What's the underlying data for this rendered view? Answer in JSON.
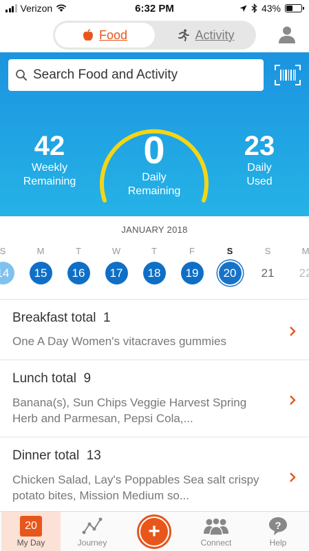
{
  "status_bar": {
    "carrier": "Verizon",
    "time": "6:32 PM",
    "battery": "43%",
    "battery_level": 0.43
  },
  "header": {
    "tabs": [
      {
        "label": "Food",
        "icon": "apple-icon",
        "active": true
      },
      {
        "label": "Activity",
        "icon": "runner-icon",
        "active": false
      }
    ],
    "profile_icon": "person-icon"
  },
  "search": {
    "placeholder": "Search Food and Activity",
    "barcode_icon": "barcode-scanner-icon"
  },
  "summary": {
    "weekly": {
      "value": "42",
      "label_line1": "Weekly",
      "label_line2": "Remaining"
    },
    "daily": {
      "value": "0",
      "label_line1": "Daily",
      "label_line2": "Remaining"
    },
    "used": {
      "value": "23",
      "label_line1": "Daily",
      "label_line2": "Used"
    },
    "gauge_color": "#f4d616",
    "hero_color": "#1c93e0"
  },
  "calendar": {
    "month": "JANUARY 2018",
    "weekdays": [
      "S",
      "M",
      "T",
      "W",
      "T",
      "F",
      "S",
      "S",
      "M"
    ],
    "selected_weekday_index": 6,
    "dates": [
      "14",
      "15",
      "16",
      "17",
      "18",
      "19",
      "20",
      "21",
      "22"
    ],
    "selected_date": "20"
  },
  "meals": [
    {
      "name": "Breakfast total",
      "total": "1",
      "items": "One A Day Women's vitacraves gummies"
    },
    {
      "name": "Lunch total",
      "total": "9",
      "items": "Banana(s), Sun Chips Veggie Harvest Spring Herb and Parmesan, Pepsi Cola,..."
    },
    {
      "name": "Dinner total",
      "total": "13",
      "items": "Chicken Salad, Lay's Poppables Sea salt crispy potato bites, Mission Medium so..."
    }
  ],
  "tabbar": {
    "items": [
      {
        "label": "My Day",
        "icon": "calendar-icon",
        "badge": "20",
        "active": true
      },
      {
        "label": "Journey",
        "icon": "journey-graph-icon"
      },
      {
        "label": "",
        "icon": "add-icon"
      },
      {
        "label": "Connect",
        "icon": "community-icon"
      },
      {
        "label": "Help",
        "icon": "help-bubble-icon"
      }
    ]
  },
  "accent_color": "#e8561b"
}
